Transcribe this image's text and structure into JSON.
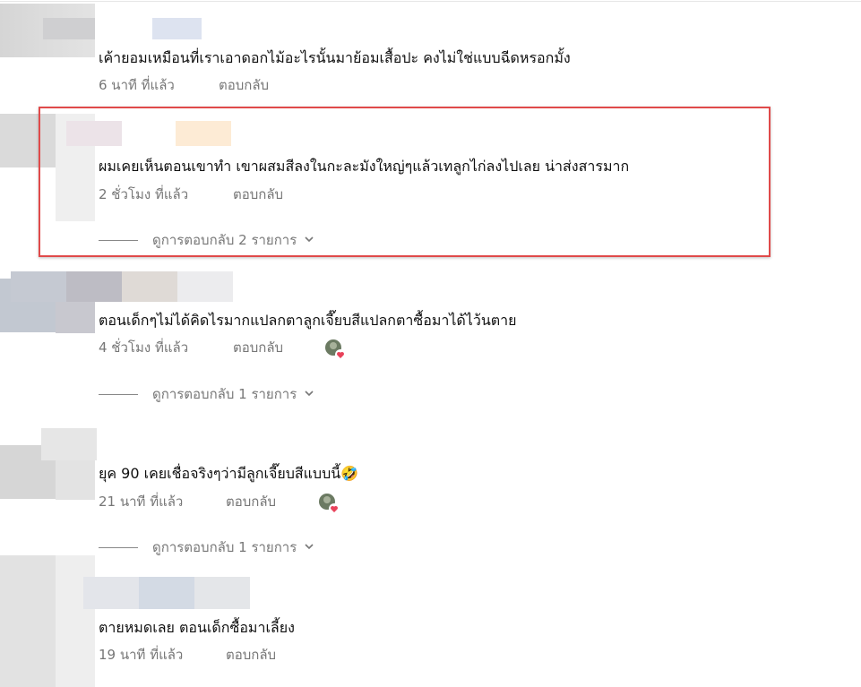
{
  "comments": [
    {
      "text": "เค้ายอมเหมือนที่เราเอาดอกไม้อะไรนั้นมาย้อมเสื้อปะ คงไม่ใช่แบบฉีดหรอกมั้ง",
      "time": "6 นาที ที่แล้ว",
      "reply_label": "ตอบกลับ"
    },
    {
      "text": "ผมเคยเห็นตอนเขาทำ เขาผสมสีลงในกะละมังใหญ่ๆแล้วเทลูกไก่ลงไปเลย น่าส่งสารมาก",
      "time": "2 ชั่วโมง ที่แล้ว",
      "reply_label": "ตอบกลับ",
      "view_replies": "ดูการตอบกลับ 2 รายการ"
    },
    {
      "text": "ตอนเด็กๆไม่ได้คิดไรมากแปลกตาลูกเจี๊ยบสีแปลกตาซื้อมาได้ไว้นตาย",
      "time": "4 ชั่วโมง ที่แล้ว",
      "reply_label": "ตอบกลับ",
      "view_replies": "ดูการตอบกลับ 1 รายการ"
    },
    {
      "text": "ยุค 90 เคยเชื่อจริงๆว่ามีลูกเจี๊ยบสีแบบนี้🤣",
      "time": "21 นาที ที่แล้ว",
      "reply_label": "ตอบกลับ",
      "view_replies": "ดูการตอบกลับ 1 รายการ"
    },
    {
      "text": "ตายหมดเลย ตอนเด็กซื้อมาเลี้ยง",
      "time": "19 นาที ที่แล้ว",
      "reply_label": "ตอบกลับ"
    }
  ],
  "colors": {
    "highlight": "#e04a4a",
    "meta_text": "#777777",
    "heart": "#e8425a"
  },
  "icons": {
    "chevron": "chevron-down-icon",
    "creator_heart": "creator-heart-avatar-icon"
  }
}
